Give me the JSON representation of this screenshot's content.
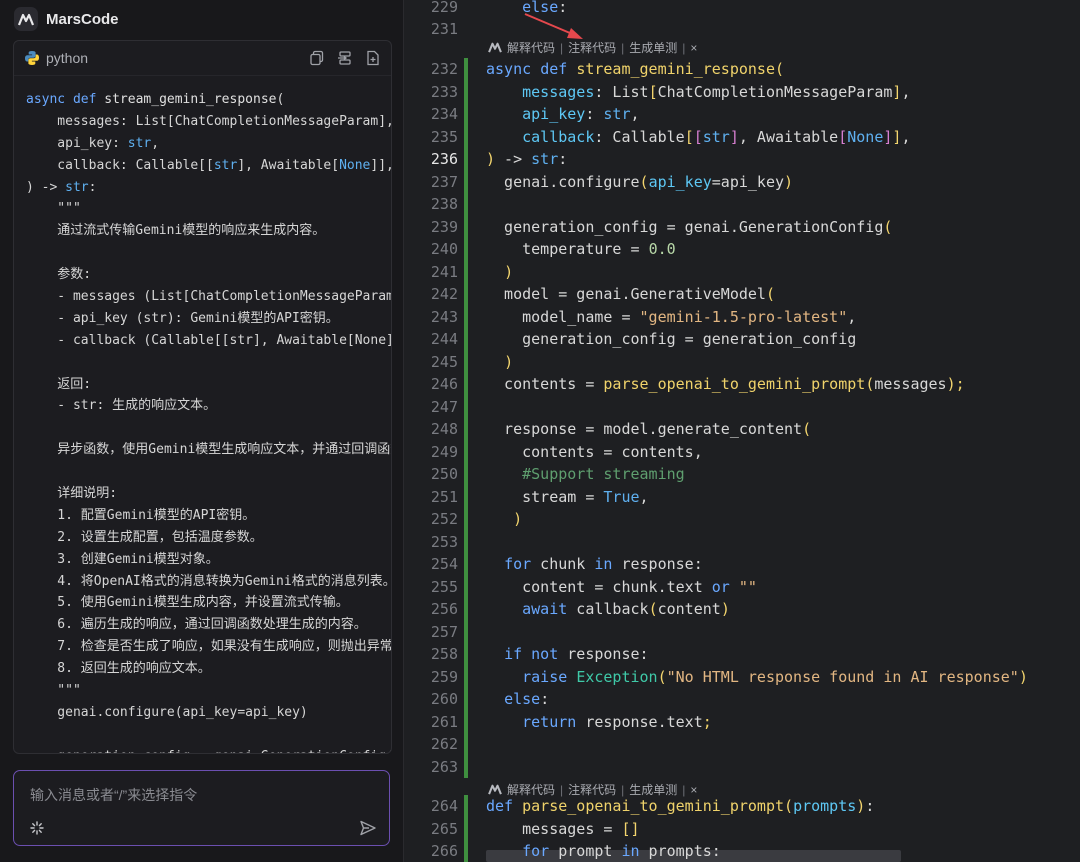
{
  "app": {
    "name": "MarsCode"
  },
  "chat": {
    "code_card": {
      "language": "python",
      "lines": [
        "async def stream_gemini_response(",
        "    messages: List[ChatCompletionMessageParam],",
        "    api_key: str,",
        "    callback: Callable[[str], Awaitable[None]],",
        ") -> str:",
        "    \"\"\"",
        "    通过流式传输Gemini模型的响应来生成内容。",
        "",
        "    参数:",
        "    - messages (List[ChatCompletionMessageParam]): 消息列表",
        "    - api_key (str): Gemini模型的API密钥。",
        "    - callback (Callable[[str], Awaitable[None]]): 回调函数",
        "",
        "    返回:",
        "    - str: 生成的响应文本。",
        "",
        "    异步函数，使用Gemini模型生成响应文本，并通过回调函数处理",
        "",
        "    详细说明:",
        "    1. 配置Gemini模型的API密钥。",
        "    2. 设置生成配置，包括温度参数。",
        "    3. 创建Gemini模型对象。",
        "    4. 将OpenAI格式的消息转换为Gemini格式的消息列表。",
        "    5. 使用Gemini模型生成内容，并设置流式传输。",
        "    6. 遍历生成的响应，通过回调函数处理生成的内容。",
        "    7. 检查是否生成了响应，如果没有生成响应，则抛出异常。",
        "    8. 返回生成的响应文本。",
        "    \"\"\"",
        "    genai.configure(api_key=api_key)",
        "",
        "    generation_config = genai.GenerationConfig("
      ]
    },
    "input": {
      "placeholder": "输入消息或者“/”来选择指令"
    }
  },
  "editor": {
    "code_lens": {
      "explain": "解释代码",
      "comment": "注释代码",
      "unit_test": "生成单测",
      "close": "×"
    },
    "current_line": 236
  }
}
